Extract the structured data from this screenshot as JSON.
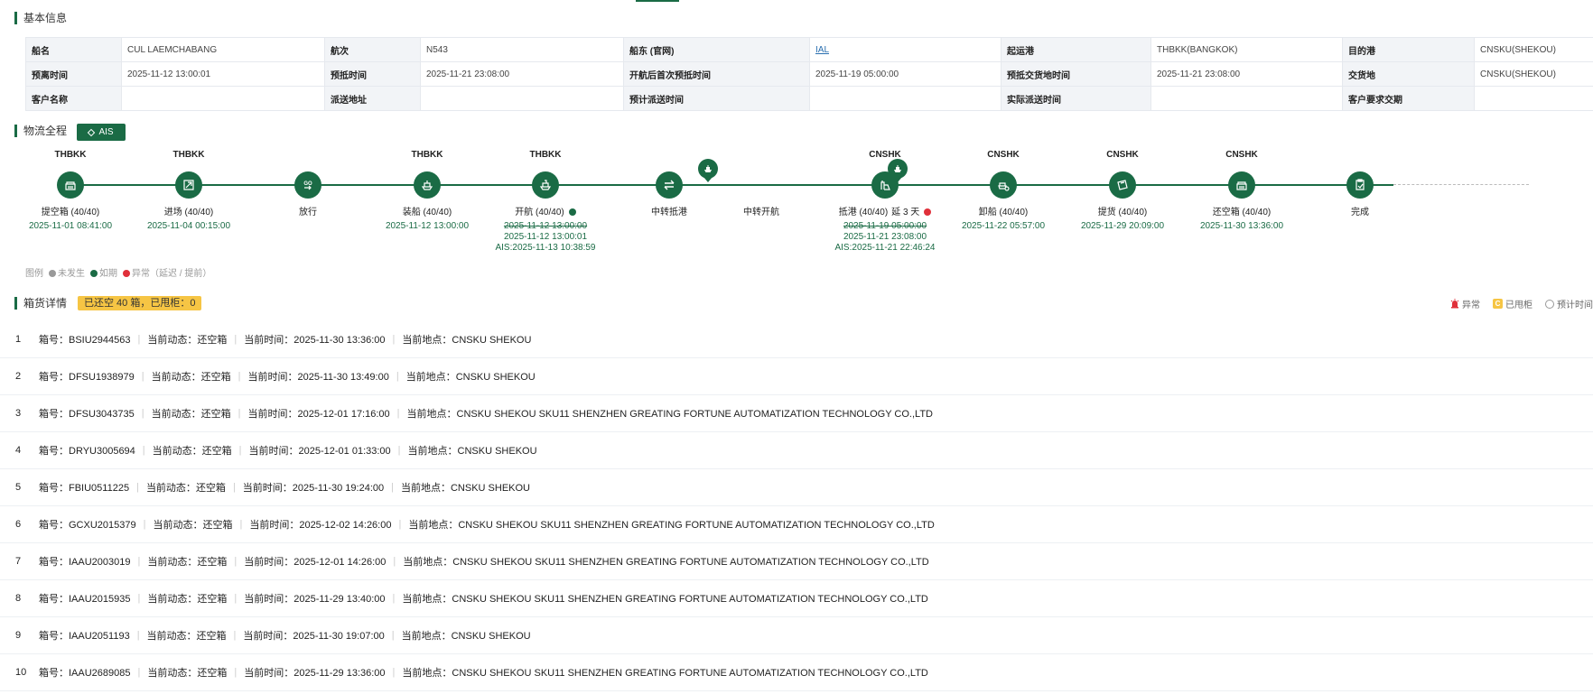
{
  "basic": {
    "title": "基本信息",
    "rows": [
      [
        {
          "label": "船名",
          "value": "CUL LAEMCHABANG"
        },
        {
          "label": "航次",
          "value": "N543"
        },
        {
          "label": "船东 (官网)",
          "value": "IAL",
          "link": true
        },
        {
          "label": "起运港",
          "value": "THBKK(BANGKOK)"
        },
        {
          "label": "目的港",
          "value": "CNSKU(SHEKOU)"
        }
      ],
      [
        {
          "label": "预离时间",
          "value": "2025-11-12 13:00:01"
        },
        {
          "label": "预抵时间",
          "value": "2025-11-21 23:08:00"
        },
        {
          "label": "开航后首次预抵时间",
          "value": "2025-11-19 05:00:00"
        },
        {
          "label": "预抵交货地时间",
          "value": "2025-11-21 23:08:00"
        },
        {
          "label": "交货地",
          "value": "CNSKU(SHEKOU)"
        }
      ],
      [
        {
          "label": "客户名称",
          "value": ""
        },
        {
          "label": "派送地址",
          "value": ""
        },
        {
          "label": "预计派送时间",
          "value": ""
        },
        {
          "label": "实际派送时间",
          "value": ""
        },
        {
          "label": "客户要求交期",
          "value": ""
        }
      ]
    ]
  },
  "logistics": {
    "title": "物流全程",
    "ais_label": "AIS",
    "nodes": [
      {
        "id": "pickup",
        "port": "THBKK",
        "label": "提空箱 (40/40)",
        "times": [
          "2025-11-01 08:41:00"
        ]
      },
      {
        "id": "gate-in",
        "port": "THBKK",
        "label": "进场 (40/40)",
        "times": [
          "2025-11-04 00:15:00"
        ]
      },
      {
        "id": "release",
        "port": "",
        "label": "放行",
        "times": []
      },
      {
        "id": "loading",
        "port": "THBKK",
        "label": "装船 (40/40)",
        "times": [
          "2025-11-12 13:00:00"
        ]
      },
      {
        "id": "departure",
        "port": "THBKK",
        "label": "开航 (40/40)",
        "times": [
          "2025-11-12 13:00:00",
          "2025-11-12 13:00:01",
          "AIS:2025-11-13 10:38:59"
        ]
      },
      {
        "id": "transship-arrive",
        "port": "",
        "label": "中转抵港",
        "times": []
      },
      {
        "id": "transship-depart",
        "port": "",
        "label": "中转开航",
        "times": []
      },
      {
        "id": "arrival",
        "port": "CNSHK",
        "label": "抵港 (40/40)",
        "delay": "延 3 天",
        "times": [
          "2025-11-19 05:00:00",
          "2025-11-21 23:08:00",
          "AIS:2025-11-21 22:46:24"
        ]
      },
      {
        "id": "discharge",
        "port": "CNSHK",
        "label": "卸船 (40/40)",
        "times": [
          "2025-11-22 05:57:00"
        ]
      },
      {
        "id": "delivery",
        "port": "CNSHK",
        "label": "提货 (40/40)",
        "times": [
          "2025-11-29 20:09:00"
        ]
      },
      {
        "id": "return",
        "port": "CNSHK",
        "label": "还空箱 (40/40)",
        "times": [
          "2025-11-30 13:36:00"
        ]
      },
      {
        "id": "complete",
        "port": "",
        "label": "完成",
        "times": []
      }
    ],
    "legend": {
      "title": "图例",
      "items": [
        {
          "label": "未发生",
          "color": "#999999"
        },
        {
          "label": "如期",
          "color": "#1a6b45"
        },
        {
          "label": "异常（延迟 / 提前）",
          "color": "#e0303a"
        }
      ]
    }
  },
  "containers": {
    "title": "箱货详情",
    "summary": "已还空 40 箱，已甩柜：0",
    "right_legend": {
      "abnormal": "异常",
      "shutout": "已甩柜",
      "estimated": "预计时间"
    },
    "field_labels": {
      "no": "箱号：",
      "status": "当前动态：",
      "time": "当前时间：",
      "place": "当前地点："
    },
    "rows": [
      {
        "idx": "1",
        "no": "BSIU2944563",
        "status": "还空箱",
        "time": "2025-11-30 13:36:00",
        "place": "CNSKU SHEKOU"
      },
      {
        "idx": "2",
        "no": "DFSU1938979",
        "status": "还空箱",
        "time": "2025-11-30 13:49:00",
        "place": "CNSKU SHEKOU"
      },
      {
        "idx": "3",
        "no": "DFSU3043735",
        "status": "还空箱",
        "time": "2025-12-01 17:16:00",
        "place": "CNSKU SHEKOU SKU11 SHENZHEN GREATING FORTUNE AUTOMATIZATION TECHNOLOGY CO.,LTD"
      },
      {
        "idx": "4",
        "no": "DRYU3005694",
        "status": "还空箱",
        "time": "2025-12-01 01:33:00",
        "place": "CNSKU SHEKOU"
      },
      {
        "idx": "5",
        "no": "FBIU0511225",
        "status": "还空箱",
        "time": "2025-11-30 19:24:00",
        "place": "CNSKU SHEKOU"
      },
      {
        "idx": "6",
        "no": "GCXU2015379",
        "status": "还空箱",
        "time": "2025-12-02 14:26:00",
        "place": "CNSKU SHEKOU SKU11 SHENZHEN GREATING FORTUNE AUTOMATIZATION TECHNOLOGY CO.,LTD"
      },
      {
        "idx": "7",
        "no": "IAAU2003019",
        "status": "还空箱",
        "time": "2025-12-01 14:26:00",
        "place": "CNSKU SHEKOU SKU11 SHENZHEN GREATING FORTUNE AUTOMATIZATION TECHNOLOGY CO.,LTD"
      },
      {
        "idx": "8",
        "no": "IAAU2015935",
        "status": "还空箱",
        "time": "2025-11-29 13:40:00",
        "place": "CNSKU SHEKOU SKU11 SHENZHEN GREATING FORTUNE AUTOMATIZATION TECHNOLOGY CO.,LTD"
      },
      {
        "idx": "9",
        "no": "IAAU2051193",
        "status": "还空箱",
        "time": "2025-11-30 19:07:00",
        "place": "CNSKU SHEKOU"
      },
      {
        "idx": "10",
        "no": "IAAU2689085",
        "status": "还空箱",
        "time": "2025-11-29 13:36:00",
        "place": "CNSKU SHEKOU SKU11 SHENZHEN GREATING FORTUNE AUTOMATIZATION TECHNOLOGY CO.,LTD"
      }
    ]
  }
}
